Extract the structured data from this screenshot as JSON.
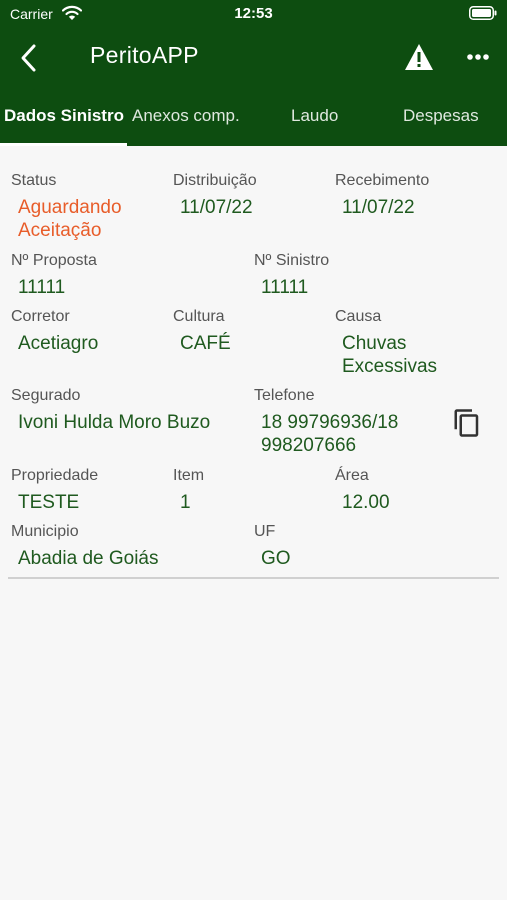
{
  "status_bar": {
    "carrier": "Carrier",
    "time": "12:53"
  },
  "header": {
    "title": "PeritoAPP"
  },
  "tabs": [
    {
      "label": "Dados Sinistro"
    },
    {
      "label": "Anexos comp."
    },
    {
      "label": "Laudo"
    },
    {
      "label": "Despesas"
    }
  ],
  "fields": {
    "status": {
      "label": "Status",
      "value": "Aguardando Aceitação"
    },
    "distribuicao": {
      "label": "Distribuição",
      "value": "11/07/22"
    },
    "recebimento": {
      "label": "Recebimento",
      "value": "11/07/22"
    },
    "proposta": {
      "label": "Nº Proposta",
      "value": "11111"
    },
    "sinistro": {
      "label": "Nº Sinistro",
      "value": "11111"
    },
    "corretor": {
      "label": "Corretor",
      "value": "Acetiagro"
    },
    "cultura": {
      "label": "Cultura",
      "value": "CAFÉ"
    },
    "causa": {
      "label": "Causa",
      "value": "Chuvas Excessivas"
    },
    "segurado": {
      "label": "Segurado",
      "value": "Ivoni Hulda Moro Buzo"
    },
    "telefone": {
      "label": "Telefone",
      "value": "18 99796936/18 998207666"
    },
    "propriedade": {
      "label": "Propriedade",
      "value": "TESTE"
    },
    "item": {
      "label": "Item",
      "value": "1"
    },
    "area": {
      "label": "Área",
      "value": "12.00"
    },
    "municipio": {
      "label": "Municipio",
      "value": "Abadia de Goiás"
    },
    "uf": {
      "label": "UF",
      "value": "GO"
    }
  },
  "colors": {
    "primary": "#0d4d10",
    "value_text": "#1f5a1f",
    "status_alert": "#e85d2a"
  }
}
